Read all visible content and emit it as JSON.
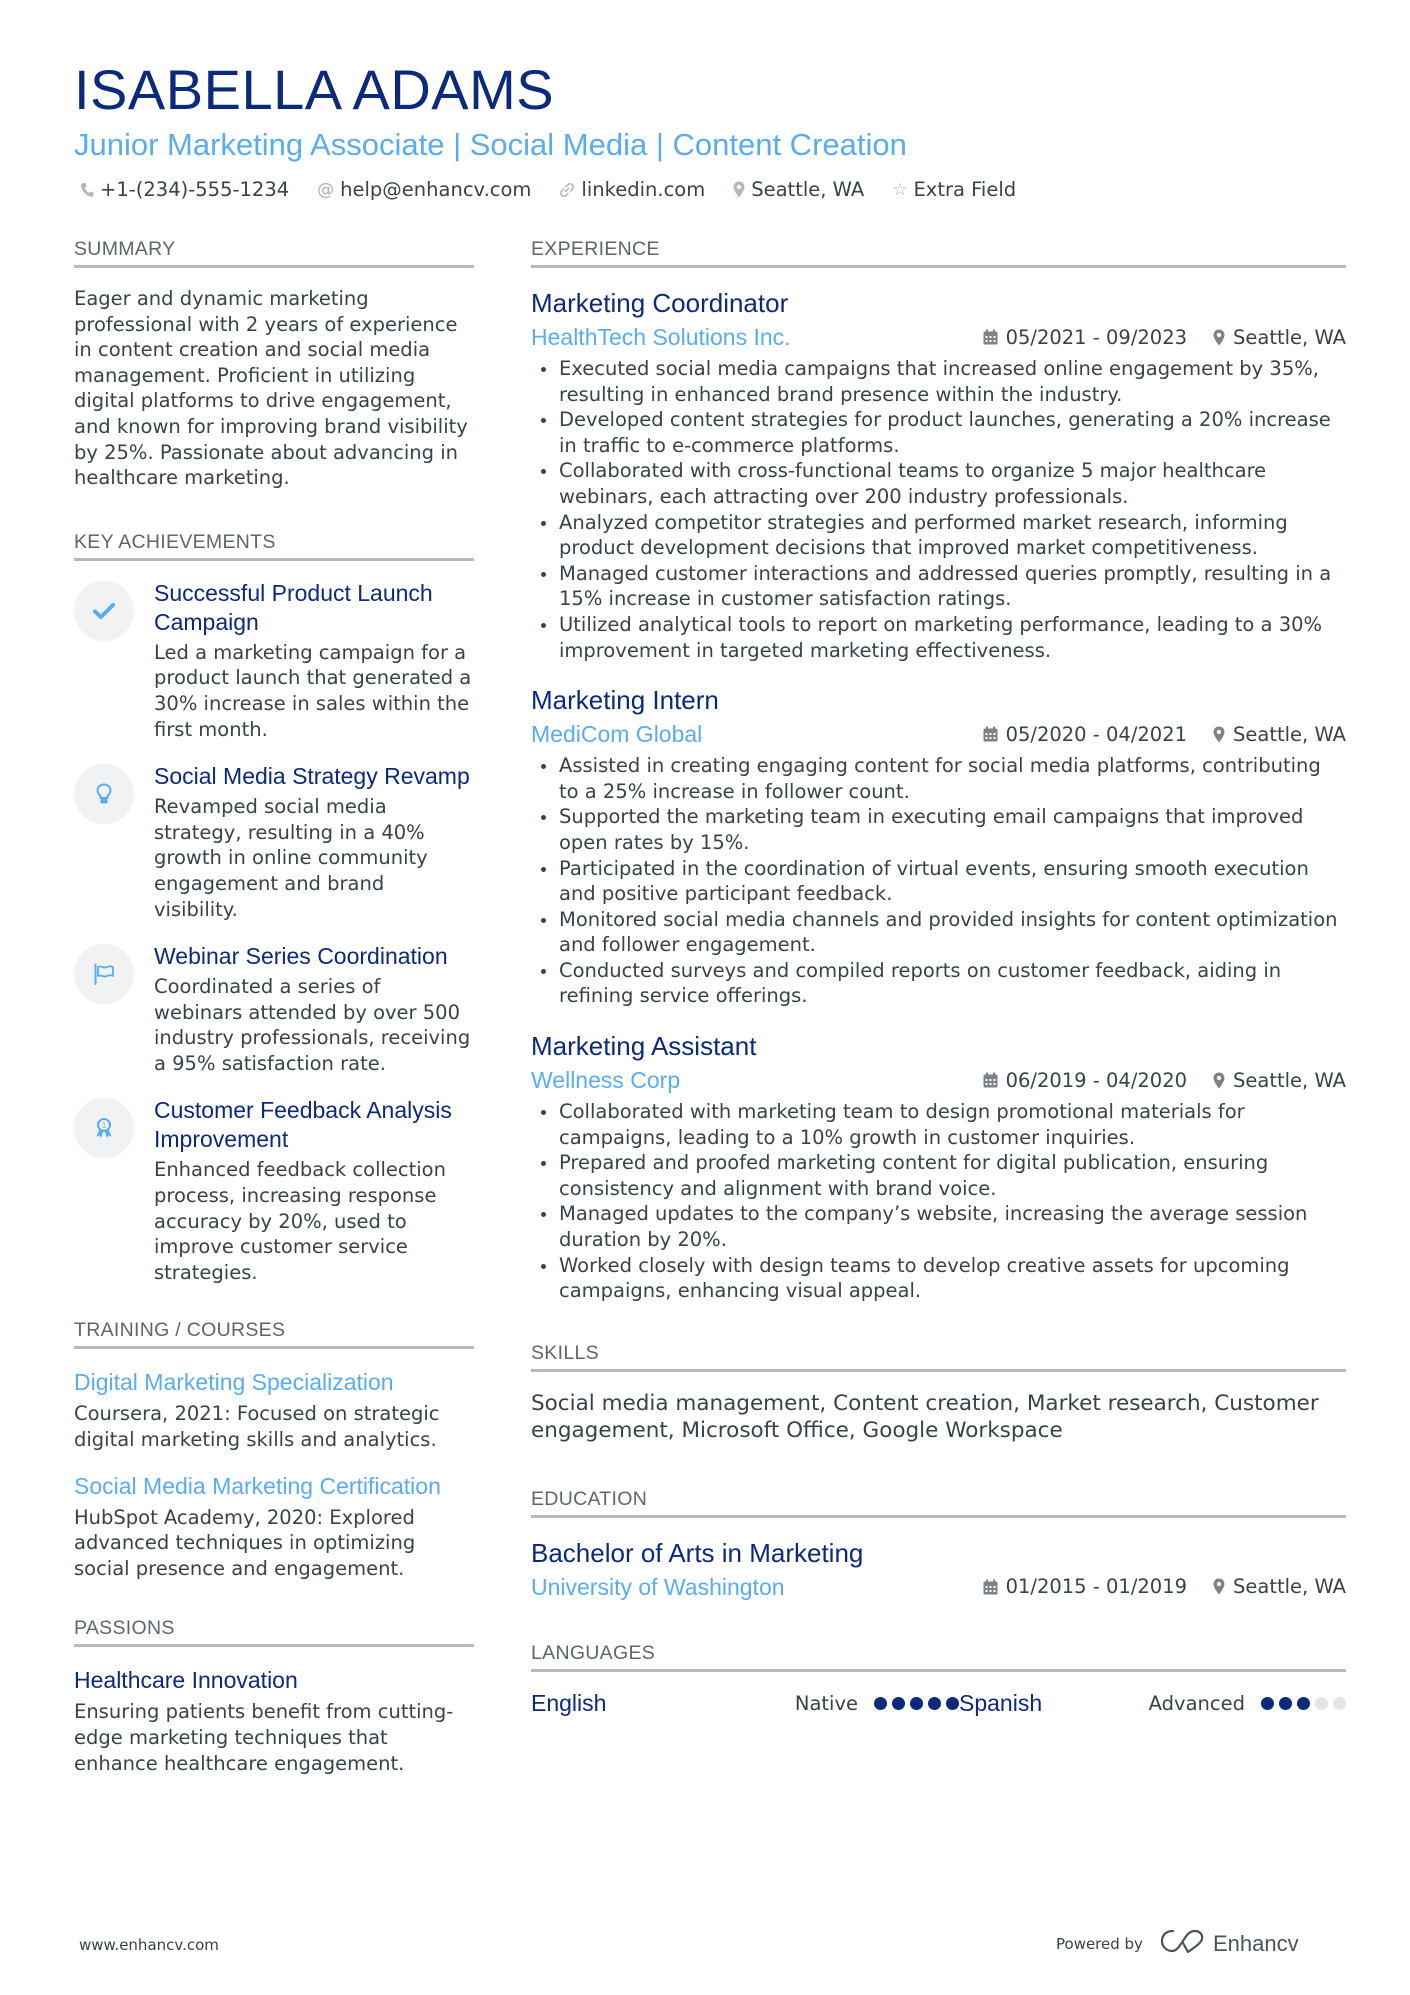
{
  "header": {
    "name": "ISABELLA ADAMS",
    "title": "Junior Marketing Associate | Social Media | Content Creation",
    "contacts": [
      {
        "icon": "phone-icon",
        "text": "+1-(234)-555-1234"
      },
      {
        "icon": "at-icon",
        "text": "help@enhancv.com"
      },
      {
        "icon": "link-icon",
        "text": "linkedin.com"
      },
      {
        "icon": "location-icon",
        "text": "Seattle, WA"
      },
      {
        "icon": "star-icon",
        "text": "Extra Field"
      }
    ]
  },
  "sections": {
    "summary": "SUMMARY",
    "achievements": "KEY ACHIEVEMENTS",
    "training": "TRAINING / COURSES",
    "passions": "PASSIONS",
    "experience": "EXPERIENCE",
    "skills": "SKILLS",
    "education": "EDUCATION",
    "languages": "LANGUAGES"
  },
  "summary": "Eager and dynamic marketing professional with 2 years of experience in content creation and social media management. Proficient in utilizing digital platforms to drive engagement, and known for improving brand visibility by 25%. Passionate about advancing in healthcare marketing.",
  "achievements": [
    {
      "icon": "checkmark-icon",
      "title": "Successful Product Launch Campaign",
      "text": "Led a marketing campaign for a product launch that generated a 30% increase in sales within the first month."
    },
    {
      "icon": "lightbulb-icon",
      "title": "Social Media Strategy Revamp",
      "text": "Revamped social media strategy, resulting in a 40% growth in online community engagement and brand visibility."
    },
    {
      "icon": "flag-icon",
      "title": "Webinar Series Coordination",
      "text": "Coordinated a series of webinars attended by over 500 industry professionals, receiving a 95% satisfaction rate."
    },
    {
      "icon": "award-ribbon-icon",
      "title": "Customer Feedback Analysis Improvement",
      "text": "Enhanced feedback collection process, increasing response accuracy by 20%, used to improve customer service strategies."
    }
  ],
  "training": [
    {
      "title": "Digital Marketing Specialization",
      "text": "Coursera, 2021: Focused on strategic digital marketing skills and analytics."
    },
    {
      "title": "Social Media Marketing Certification",
      "text": "HubSpot Academy, 2020: Explored advanced techniques in optimizing social presence and engagement."
    }
  ],
  "passions": [
    {
      "title": "Healthcare Innovation",
      "text": "Ensuring patients benefit from cutting-edge marketing techniques that enhance healthcare engagement."
    }
  ],
  "experience": [
    {
      "title": "Marketing Coordinator",
      "company": "HealthTech Solutions Inc.",
      "dates": "05/2021 - 09/2023",
      "location": "Seattle, WA",
      "bullets": [
        "Executed social media campaigns that increased online engagement by 35%, resulting in enhanced brand presence within the industry.",
        "Developed content strategies for product launches, generating a 20% increase in traffic to e-commerce platforms.",
        "Collaborated with cross-functional teams to organize 5 major healthcare webinars, each attracting over 200 industry professionals.",
        "Analyzed competitor strategies and performed market research, informing product development decisions that improved market competitiveness.",
        "Managed customer interactions and addressed queries promptly, resulting in a 15% increase in customer satisfaction ratings.",
        "Utilized analytical tools to report on marketing performance, leading to a 30% improvement in targeted marketing effectiveness."
      ]
    },
    {
      "title": "Marketing Intern",
      "company": "MediCom Global",
      "dates": "05/2020 - 04/2021",
      "location": "Seattle, WA",
      "bullets": [
        "Assisted in creating engaging content for social media platforms, contributing to a 25% increase in follower count.",
        "Supported the marketing team in executing email campaigns that improved open rates by 15%.",
        "Participated in the coordination of virtual events, ensuring smooth execution and positive participant feedback.",
        "Monitored social media channels and provided insights for content optimization and follower engagement.",
        "Conducted surveys and compiled reports on customer feedback, aiding in refining service offerings."
      ]
    },
    {
      "title": "Marketing Assistant",
      "company": "Wellness Corp",
      "dates": "06/2019 - 04/2020",
      "location": "Seattle, WA",
      "bullets": [
        "Collaborated with marketing team to design promotional materials for campaigns, leading to a 10% growth in customer inquiries.",
        "Prepared and proofed marketing content for digital publication, ensuring consistency and alignment with brand voice.",
        "Managed updates to the company’s website, increasing the average session duration by 20%.",
        "Worked closely with design teams to develop creative assets for upcoming campaigns, enhancing visual appeal."
      ]
    }
  ],
  "skills": "Social media management, Content creation, Market research, Customer engagement, Microsoft Office, Google Workspace",
  "education": [
    {
      "degree": "Bachelor of Arts in Marketing",
      "school": "University of Washington",
      "dates": "01/2015 - 01/2019",
      "location": "Seattle, WA"
    }
  ],
  "languages": [
    {
      "name": "English",
      "level": "Native",
      "rating": 5,
      "max": 5
    },
    {
      "name": "Spanish",
      "level": "Advanced",
      "rating": 3,
      "max": 5
    }
  ],
  "footer": {
    "website": "www.enhancv.com",
    "powered_by": "Powered by",
    "brand": "Enhancv"
  },
  "colors": {
    "name": "#0b2a7c",
    "accent": "#5aacf0",
    "text": "#384347",
    "divider": "#b6babd"
  }
}
